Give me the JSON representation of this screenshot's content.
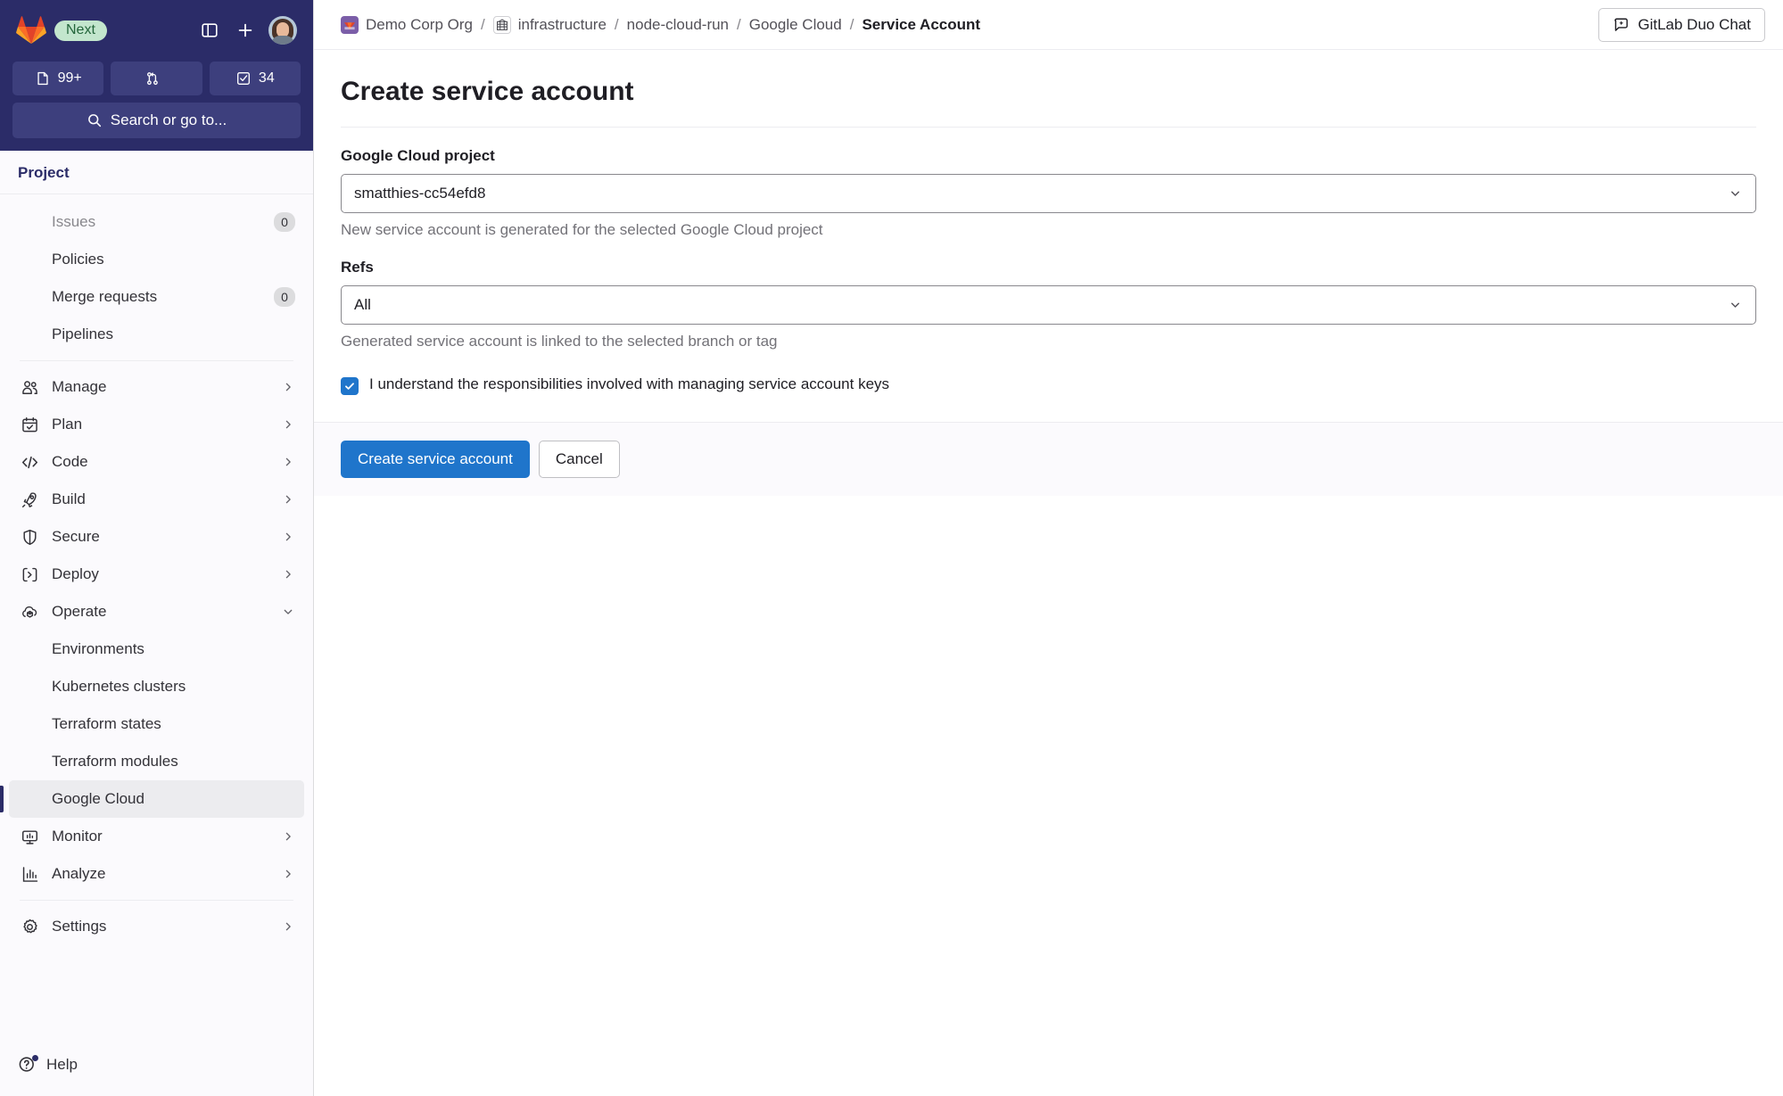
{
  "sidebar": {
    "brand": {
      "logo_icon": "gitlab-logo-icon",
      "badge_label": "Next"
    },
    "top_actions": [
      {
        "icon": "sidebar-toggle-icon",
        "name": "toggle-sidebar-button"
      },
      {
        "icon": "plus-icon",
        "name": "create-new-button"
      }
    ],
    "avatar_name": "user-avatar",
    "counts": [
      {
        "icon": "issues-icon",
        "value": "99+",
        "name": "issues-count-button"
      },
      {
        "icon": "merge-request-icon",
        "value": "",
        "name": "merge-requests-count-button"
      },
      {
        "icon": "todos-icon",
        "value": "34",
        "name": "todos-count-button"
      }
    ],
    "search": {
      "placeholder": "Search or go to...",
      "icon": "search-icon"
    },
    "scope_title": "Project",
    "items": [
      {
        "label": "Issues",
        "badge": "0",
        "icon": "",
        "chevron": "",
        "indent": true,
        "muted": true
      },
      {
        "label": "Policies",
        "badge": "",
        "icon": "",
        "chevron": "",
        "indent": true
      },
      {
        "label": "Merge requests",
        "badge": "0",
        "icon": "",
        "chevron": "",
        "indent": true
      },
      {
        "label": "Pipelines",
        "badge": "",
        "icon": "",
        "chevron": "",
        "indent": true
      },
      {
        "separator": true
      },
      {
        "label": "Manage",
        "badge": "",
        "icon": "users-icon",
        "chevron": "right"
      },
      {
        "label": "Plan",
        "badge": "",
        "icon": "calendar-icon",
        "chevron": "right"
      },
      {
        "label": "Code",
        "badge": "",
        "icon": "code-icon",
        "chevron": "right"
      },
      {
        "label": "Build",
        "badge": "",
        "icon": "rocket-icon",
        "chevron": "right"
      },
      {
        "label": "Secure",
        "badge": "",
        "icon": "shield-icon",
        "chevron": "right"
      },
      {
        "label": "Deploy",
        "badge": "",
        "icon": "deploy-icon",
        "chevron": "right"
      },
      {
        "label": "Operate",
        "badge": "",
        "icon": "cloud-cube-icon",
        "chevron": "down"
      },
      {
        "label": "Environments",
        "badge": "",
        "icon": "",
        "chevron": "",
        "indent": true
      },
      {
        "label": "Kubernetes clusters",
        "badge": "",
        "icon": "",
        "chevron": "",
        "indent": true
      },
      {
        "label": "Terraform states",
        "badge": "",
        "icon": "",
        "chevron": "",
        "indent": true
      },
      {
        "label": "Terraform modules",
        "badge": "",
        "icon": "",
        "chevron": "",
        "indent": true
      },
      {
        "label": "Google Cloud",
        "badge": "",
        "icon": "",
        "chevron": "",
        "indent": true,
        "active": true
      },
      {
        "label": "Monitor",
        "badge": "",
        "icon": "monitor-icon",
        "chevron": "right"
      },
      {
        "label": "Analyze",
        "badge": "",
        "icon": "analytics-icon",
        "chevron": "right"
      },
      {
        "separator": true
      },
      {
        "label": "Settings",
        "badge": "",
        "icon": "gear-icon",
        "chevron": "right"
      }
    ],
    "help": {
      "label": "Help",
      "icon": "help-icon",
      "has_notification": true
    }
  },
  "topbar": {
    "breadcrumbs": [
      {
        "label": "Demo Corp Org",
        "avatar": "org-avatar",
        "current": false
      },
      {
        "label": "infrastructure",
        "avatar": "project-avatar",
        "current": false
      },
      {
        "label": "node-cloud-run",
        "avatar": "",
        "current": false
      },
      {
        "label": "Google Cloud",
        "avatar": "",
        "current": false
      },
      {
        "label": "Service Account",
        "avatar": "",
        "current": true
      }
    ],
    "separator": "/",
    "duo_chat": {
      "label": "GitLab Duo Chat",
      "icon": "duo-chat-icon"
    }
  },
  "page": {
    "title": "Create service account",
    "fields": {
      "project": {
        "label": "Google Cloud project",
        "value": "smatthies-cc54efd8",
        "hint": "New service account is generated for the selected Google Cloud project",
        "chevron_icon": "chevron-down-icon"
      },
      "refs": {
        "label": "Refs",
        "value": "All",
        "hint": "Generated service account is linked to the selected branch or tag",
        "chevron_icon": "chevron-down-icon"
      }
    },
    "checkbox": {
      "label": "I understand the responsibilities involved with managing service account keys",
      "checked": true
    },
    "actions": {
      "submit_label": "Create service account",
      "cancel_label": "Cancel"
    }
  },
  "colors": {
    "sidebar_dark": "#2b2c68",
    "primary": "#1f75cb",
    "badge_green_bg": "#c3e6cd",
    "badge_green_text": "#24663b"
  }
}
